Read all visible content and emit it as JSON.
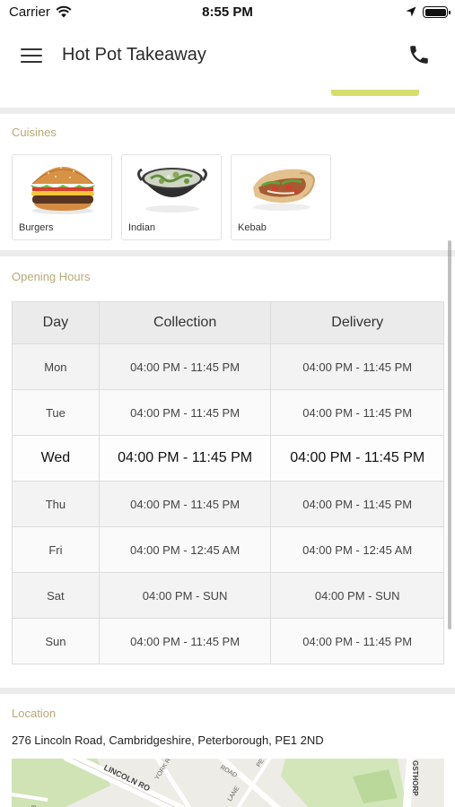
{
  "status_bar": {
    "carrier": "Carrier",
    "time": "8:55 PM"
  },
  "nav": {
    "title": "Hot Pot Takeaway"
  },
  "cuisines": {
    "label": "Cuisines",
    "items": [
      {
        "name": "Burgers",
        "icon": "burger-icon"
      },
      {
        "name": "Indian",
        "icon": "curry-bowl-icon"
      },
      {
        "name": "Kebab",
        "icon": "kebab-wrap-icon"
      }
    ]
  },
  "opening_hours": {
    "label": "Opening Hours",
    "headers": {
      "day": "Day",
      "collection": "Collection",
      "delivery": "Delivery"
    },
    "rows": [
      {
        "day": "Mon",
        "collection": "04:00 PM - 11:45 PM",
        "delivery": "04:00 PM - 11:45 PM"
      },
      {
        "day": "Tue",
        "collection": "04:00 PM - 11:45 PM",
        "delivery": "04:00 PM - 11:45 PM"
      },
      {
        "day": "Wed",
        "collection": "04:00 PM - 11:45 PM",
        "delivery": "04:00 PM - 11:45 PM",
        "today": true
      },
      {
        "day": "Thu",
        "collection": "04:00 PM - 11:45 PM",
        "delivery": "04:00 PM - 11:45 PM"
      },
      {
        "day": "Fri",
        "collection": "04:00 PM - 12:45 AM",
        "delivery": "04:00 PM - 12:45 AM"
      },
      {
        "day": "Sat",
        "collection": "04:00 PM - SUN",
        "delivery": "04:00 PM - SUN"
      },
      {
        "day": "Sun",
        "collection": "04:00 PM - 11:45 PM",
        "delivery": "04:00 PM - 11:45 PM"
      }
    ]
  },
  "location": {
    "label": "Location",
    "address": "276 Lincoln Road, Cambridgeshire, Peterborough, PE1 2ND",
    "map_labels": [
      "LINCOLN RO",
      "YORK RO",
      "ROAD",
      "PE",
      "LANE",
      "GSTHORP",
      "BO"
    ]
  },
  "colors": {
    "accent": "#d6de6d",
    "section_label": "#b7a978",
    "map_green": "#cfe3b5"
  }
}
